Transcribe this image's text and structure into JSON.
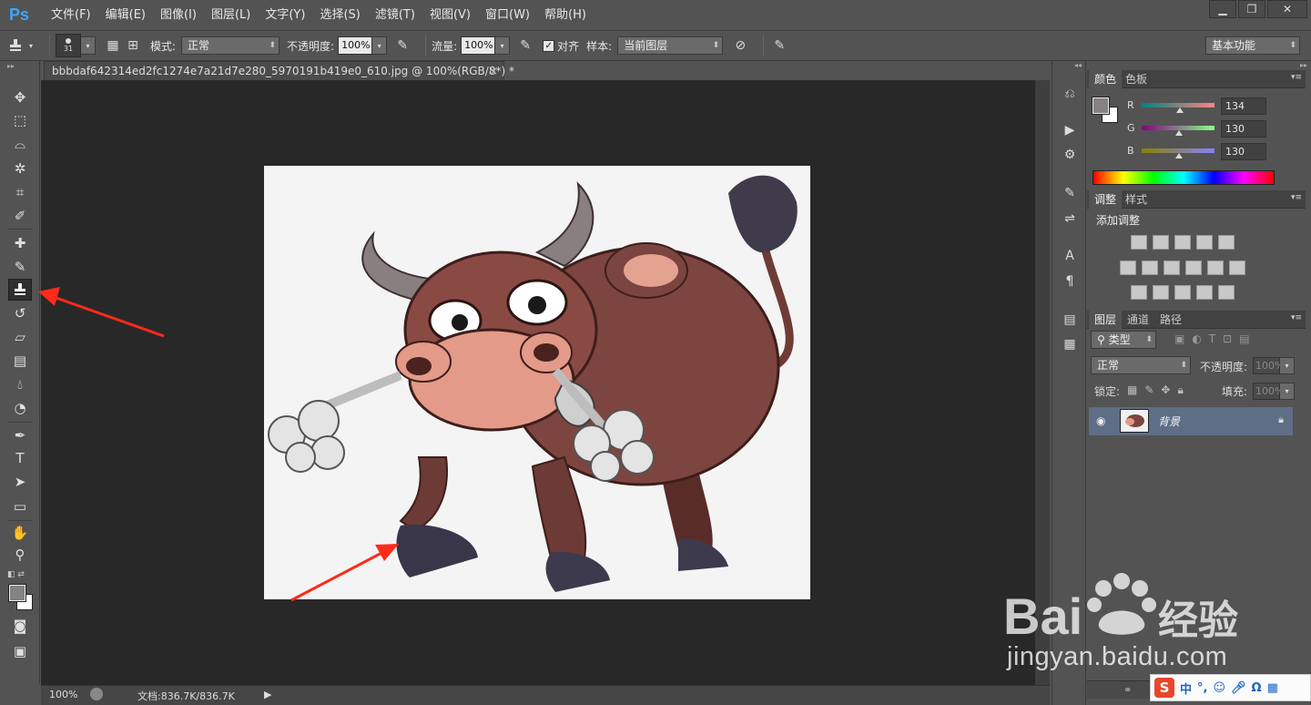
{
  "app": {
    "logo": "Ps"
  },
  "menu": [
    "文件(F)",
    "编辑(E)",
    "图像(I)",
    "图层(L)",
    "文字(Y)",
    "选择(S)",
    "滤镜(T)",
    "视图(V)",
    "窗口(W)",
    "帮助(H)"
  ],
  "window_controls": {
    "minimize": "▁",
    "maximize": "❐",
    "close": "✕"
  },
  "options": {
    "brush_size": "31",
    "mode_label": "模式:",
    "mode_value": "正常",
    "opacity_label": "不透明度:",
    "opacity_value": "100%",
    "flow_label": "流量:",
    "flow_value": "100%",
    "aligned_label": "对齐",
    "sample_label": "样本:",
    "sample_value": "当前图层",
    "workspace": "基本功能"
  },
  "document": {
    "tab_title": "bbbdaf642314ed2fc1274e7a21d7e280_5970191b419e0_610.jpg @ 100%(RGB/8*) *",
    "zoom": "100%",
    "doc_size": "文档:836.7K/836.7K"
  },
  "color_panel": {
    "tabs": [
      "颜色",
      "色板"
    ],
    "r_label": "R",
    "g_label": "G",
    "b_label": "B",
    "r": 134,
    "g": 130,
    "b": 130,
    "fg_color": "#868282"
  },
  "adjust_panel": {
    "tabs": [
      "调整",
      "样式"
    ],
    "title": "添加调整"
  },
  "layers_panel": {
    "tabs": [
      "图层",
      "通道",
      "路径"
    ],
    "filter_label": "类型",
    "blend_mode": "正常",
    "opacity_label": "不透明度:",
    "opacity_value": "100%",
    "lock_label": "锁定:",
    "fill_label": "填充:",
    "fill_value": "100%",
    "layer_name": "背景"
  },
  "watermark": {
    "text": "jingyan.baidu.com"
  },
  "ime": {
    "mode": "中"
  },
  "colors": {
    "accent_arrow": "#ff2a1a",
    "active_layer": "#5e6e86"
  }
}
